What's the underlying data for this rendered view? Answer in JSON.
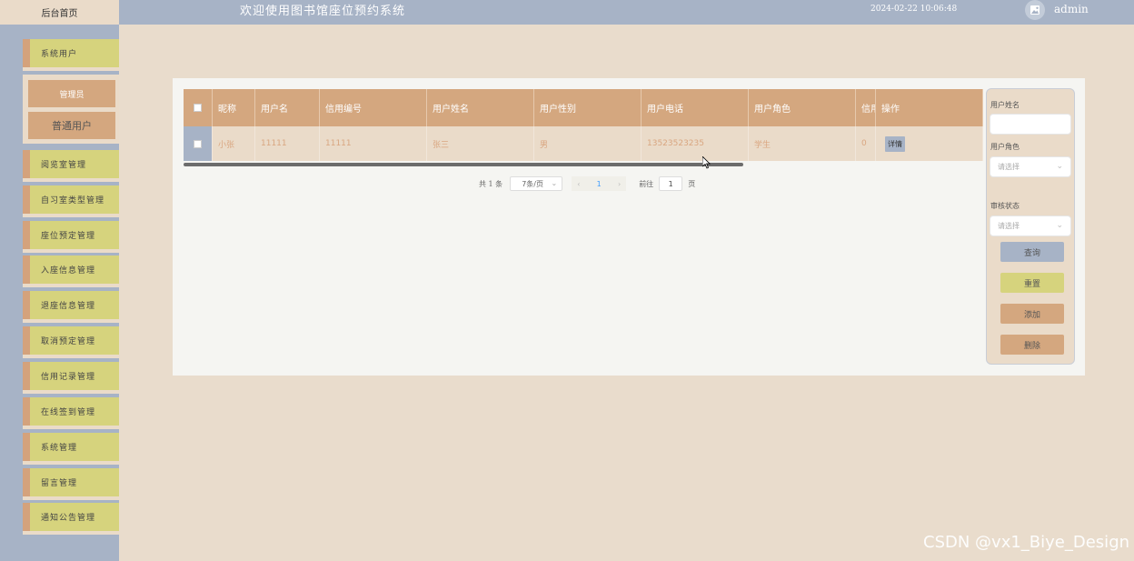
{
  "header": {
    "home_tab": "后台首页",
    "system_title": "欢迎使用图书馆座位预约系统",
    "datetime": "2024-02-22 10:06:48",
    "username": "admin",
    "avatar_icon": "image-icon"
  },
  "sidebar": {
    "items": [
      "系统用户",
      "阅览室管理",
      "自习室类型管理",
      "座位预定管理",
      "入座信息管理",
      "退座信息管理",
      "取消预定管理",
      "信用记录管理",
      "在线签到管理",
      "系统管理",
      "留言管理",
      "通知公告管理"
    ],
    "sub_items": [
      "管理员",
      "普通用户"
    ]
  },
  "table": {
    "columns": [
      "昵称",
      "用户名",
      "信用编号",
      "用户姓名",
      "用户性别",
      "用户电话",
      "用户角色",
      "信用",
      "操作"
    ],
    "rows": [
      {
        "nickname": "小张",
        "username": "11111",
        "credit_no": "11111",
        "real_name": "张三",
        "gender": "男",
        "phone": "13523523235",
        "role": "学生",
        "credit": "0",
        "action": "详情"
      }
    ]
  },
  "pagination": {
    "total": "共 1 条",
    "page_size": "7条/页",
    "current_page": "1",
    "goto_prefix": "前往",
    "goto_value": "1",
    "goto_suffix": "页",
    "prev_icon": "chevron-left-icon",
    "next_icon": "chevron-right-icon"
  },
  "search": {
    "name_label": "用户姓名",
    "name_value": "",
    "role_label": "用户角色",
    "role_placeholder": "请选择",
    "audit_label": "审核状态",
    "audit_placeholder": "请选择",
    "query_button": "查询",
    "reset_button": "重置",
    "add_button": "添加",
    "delete_button": "删除"
  },
  "watermark": "CSDN @vx1_Biye_Design",
  "colors": {
    "topbar": "#a7b3c6",
    "background": "#e9dccc",
    "menu_yellow": "#d6d37d",
    "accent_tan": "#d4a77f"
  }
}
